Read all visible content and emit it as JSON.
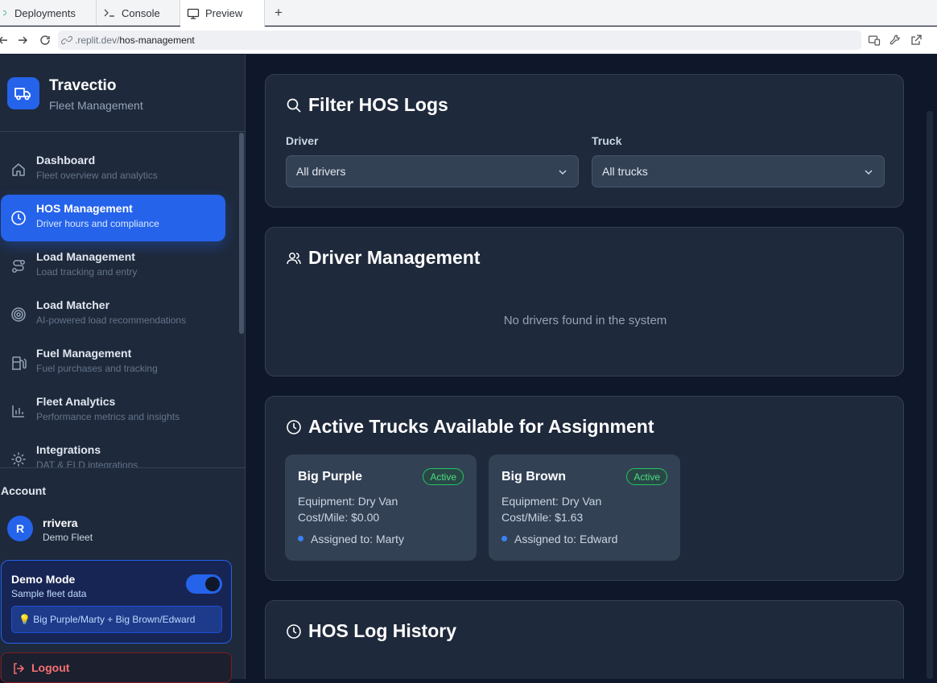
{
  "browser": {
    "tabs": [
      {
        "label": "Deployments",
        "icon": "deploy-icon"
      },
      {
        "label": "Console",
        "icon": "terminal-icon"
      },
      {
        "label": "Preview",
        "icon": "monitor-icon"
      }
    ],
    "new_tab_label": "+",
    "url_prefix": ".replit.dev/",
    "url_path": "hos-management"
  },
  "sidebar": {
    "brand_name": "Travectio",
    "brand_subtitle": "Fleet Management",
    "items": [
      {
        "title": "Dashboard",
        "subtitle": "Fleet overview and analytics",
        "icon": "home-icon",
        "active": false
      },
      {
        "title": "HOS Management",
        "subtitle": "Driver hours and compliance",
        "icon": "clock-icon",
        "active": true
      },
      {
        "title": "Load Management",
        "subtitle": "Load tracking and entry",
        "icon": "route-icon",
        "active": false
      },
      {
        "title": "Load Matcher",
        "subtitle": "AI-powered load recommendations",
        "icon": "target-icon",
        "active": false
      },
      {
        "title": "Fuel Management",
        "subtitle": "Fuel purchases and tracking",
        "icon": "fuel-icon",
        "active": false
      },
      {
        "title": "Fleet Analytics",
        "subtitle": "Performance metrics and insights",
        "icon": "bar-chart-icon",
        "active": false
      },
      {
        "title": "Integrations",
        "subtitle": "DAT & ELD integrations",
        "icon": "gear-icon",
        "active": false
      }
    ],
    "account_label": "Account",
    "user": {
      "initial": "R",
      "name": "rrivera",
      "fleet": "Demo Fleet"
    },
    "demo": {
      "title": "Demo Mode",
      "subtitle": "Sample fleet data",
      "note": "💡 Big Purple/Marty + Big Brown/Edward",
      "enabled": true
    },
    "logout_label": "Logout"
  },
  "main": {
    "filter": {
      "title": "Filter HOS Logs",
      "driver_label": "Driver",
      "driver_value": "All drivers",
      "truck_label": "Truck",
      "truck_value": "All trucks"
    },
    "drivers": {
      "title": "Driver Management",
      "empty_text": "No drivers found in the system"
    },
    "trucks": {
      "title": "Active Trucks Available for Assignment",
      "items": [
        {
          "name": "Big Purple",
          "status": "Active",
          "equipment": "Equipment: Dry Van",
          "cost": "Cost/Mile: $0.00",
          "assigned": "Assigned to: Marty"
        },
        {
          "name": "Big Brown",
          "status": "Active",
          "equipment": "Equipment: Dry Van",
          "cost": "Cost/Mile: $1.63",
          "assigned": "Assigned to: Edward"
        }
      ]
    },
    "history": {
      "title": "HOS Log History"
    }
  },
  "colors": {
    "accent": "#2563eb",
    "background": "#0f172a",
    "card": "#1e293b",
    "active_badge": "#22c55e",
    "logout": "#f87171"
  }
}
